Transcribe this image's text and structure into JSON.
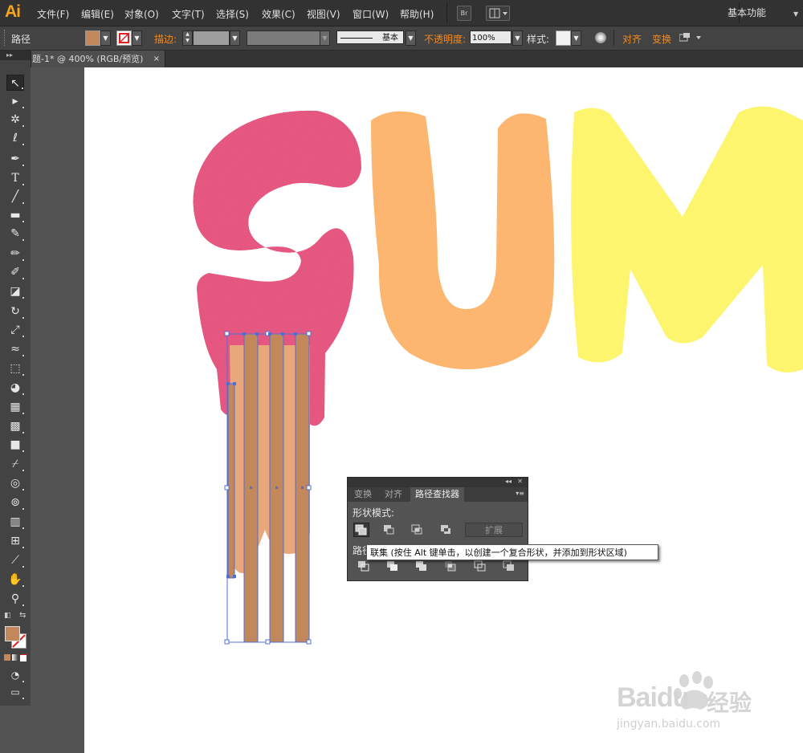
{
  "app": {
    "logo": "Ai",
    "workspace": "基本功能"
  },
  "menu": [
    "文件(F)",
    "编辑(E)",
    "对象(O)",
    "文字(T)",
    "选择(S)",
    "效果(C)",
    "视图(V)",
    "窗口(W)",
    "帮助(H)"
  ],
  "menubar_buttons": {
    "bridge": "Br"
  },
  "control": {
    "selection_type": "路径",
    "stroke_label": "描边:",
    "stroke_profile": "基本",
    "opacity_label": "不透明度:",
    "opacity_value": "100%",
    "style_label": "样式:",
    "align_label": "对齐",
    "transform_label": "变换",
    "fill_color": "#c2875a"
  },
  "document_tab": {
    "title": "题-1* @ 400% (RGB/预览)",
    "close": "×"
  },
  "panel": {
    "tabs": [
      "变换",
      "对齐",
      "路径查找器"
    ],
    "active_tab": "路径查找器",
    "shape_modes_label": "形状模式:",
    "expand_label": "扩展",
    "pathfinders_label": "路径"
  },
  "tooltip": {
    "text": "联集 (按住 Alt 键单击，以创建一个复合形状，并添加到形状区域)"
  },
  "artwork": {
    "letters": [
      "S",
      "U",
      "M"
    ],
    "colors": {
      "s": "#ee5b86",
      "u": "#fdb670",
      "m": "#fef56f",
      "drip": "#e8a87c",
      "stripes": "#c2875a",
      "selection": "#4f6fd8"
    }
  },
  "watermark": {
    "brand": "Baidu",
    "cn": "经验",
    "url": "jingyan.baidu.com"
  }
}
